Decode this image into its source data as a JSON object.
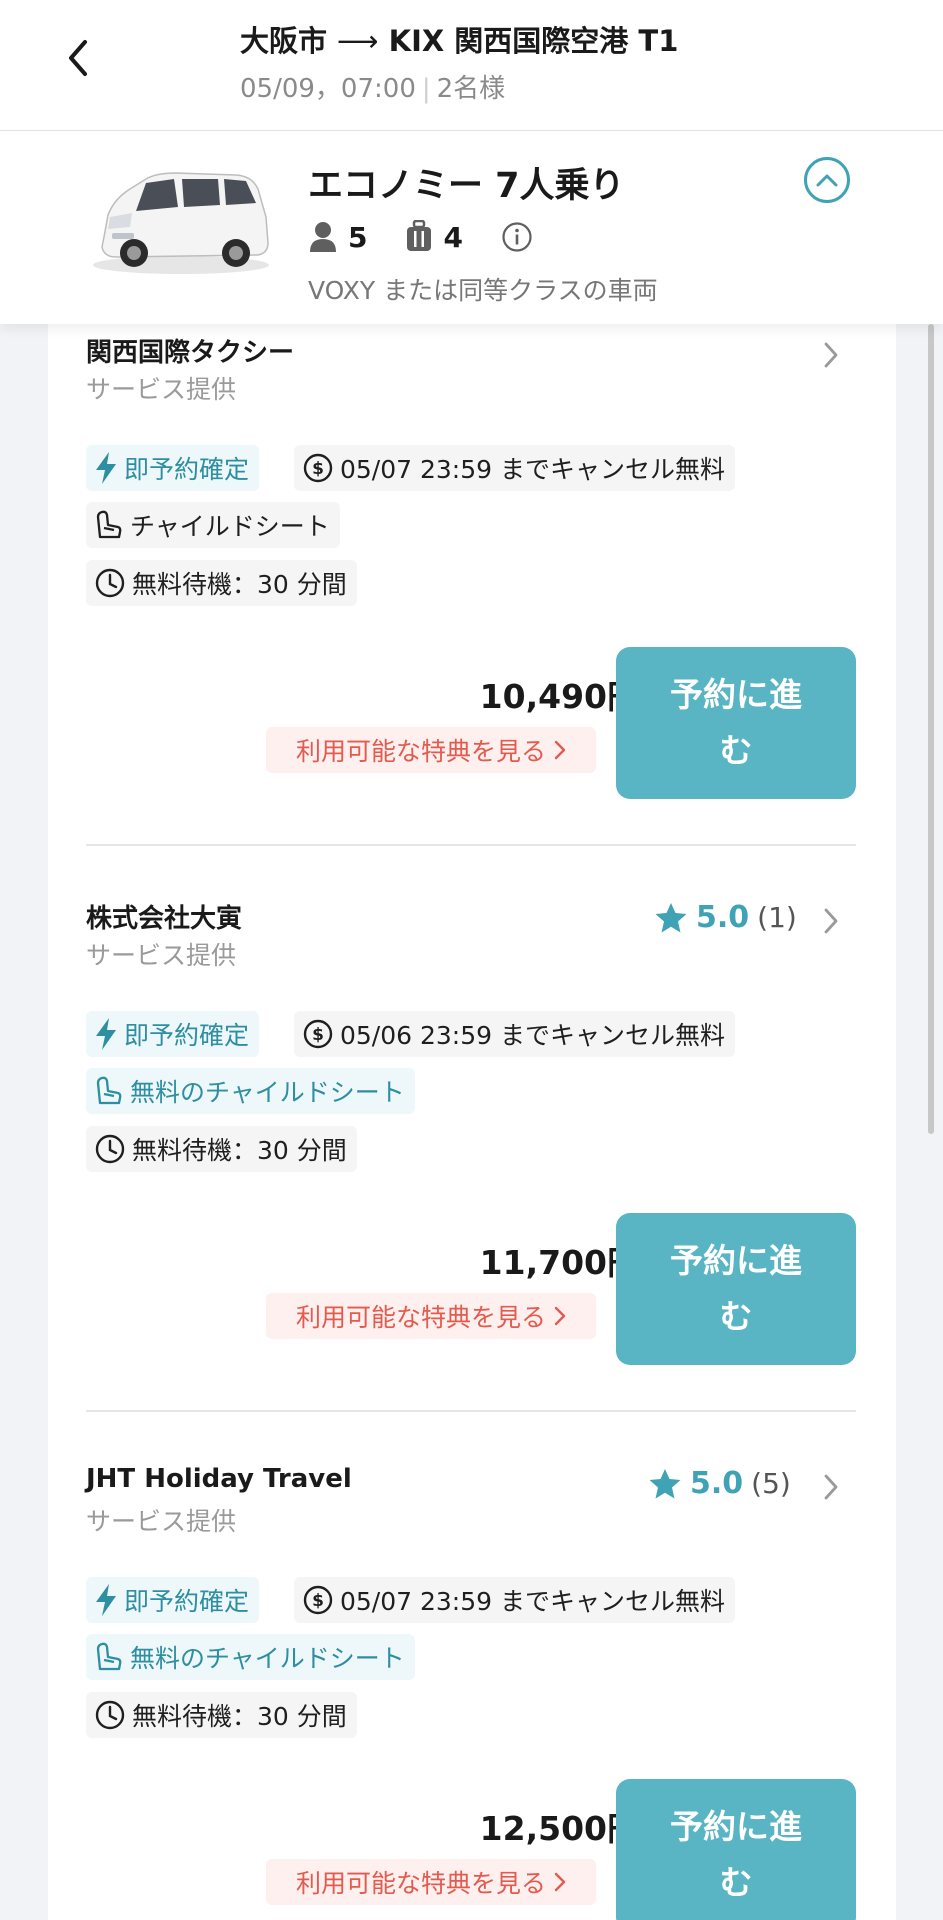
{
  "header": {
    "from": "大阪市",
    "arrow": "⟶",
    "to": "KIX 関西国際空港 T1",
    "datetime": "05/09，07:00",
    "separator": "|",
    "passengers": "2名様"
  },
  "vehicle": {
    "title": "エコノミー 7人乗り",
    "passenger_capacity": "5",
    "luggage_capacity": "4",
    "description": "VOXY または同等クラスの車両"
  },
  "providers": [
    {
      "name": "関西国際タクシー",
      "subtitle": "サービス提供",
      "instant_label": "即予約確定",
      "cancel_label": "05/07 23:59 までキャンセル無料",
      "child_seat_label": "チャイルドシート",
      "wait_label": "無料待機：30 分間",
      "price": "10,490円",
      "perks_label": "利用可能な特典を見る",
      "book_label": "予約に進む"
    },
    {
      "name": "株式会社大寅",
      "subtitle": "サービス提供",
      "rating_score": "5.0",
      "rating_count": "(1)",
      "instant_label": "即予約確定",
      "cancel_label": "05/06 23:59 までキャンセル無料",
      "child_seat_label": "無料のチャイルドシート",
      "wait_label": "無料待機：30 分間",
      "price": "11,700円",
      "perks_label": "利用可能な特典を見る",
      "book_label": "予約に進む"
    },
    {
      "name": "JHT Holiday Travel",
      "subtitle": "サービス提供",
      "rating_score": "5.0",
      "rating_count": "(5)",
      "instant_label": "即予約確定",
      "cancel_label": "05/07 23:59 までキャンセル無料",
      "child_seat_label": "無料のチャイルドシート",
      "wait_label": "無料待機：30 分間",
      "price": "12,500円",
      "perks_label": "利用可能な特典を見る",
      "book_label": "予約に進む"
    }
  ],
  "colors": {
    "accent": "#3fa3b5",
    "button": "#59b5c3",
    "perks_text": "#e35b4f",
    "perks_bg": "#fdf0ef",
    "tag_teal_bg": "#eef7f9"
  }
}
